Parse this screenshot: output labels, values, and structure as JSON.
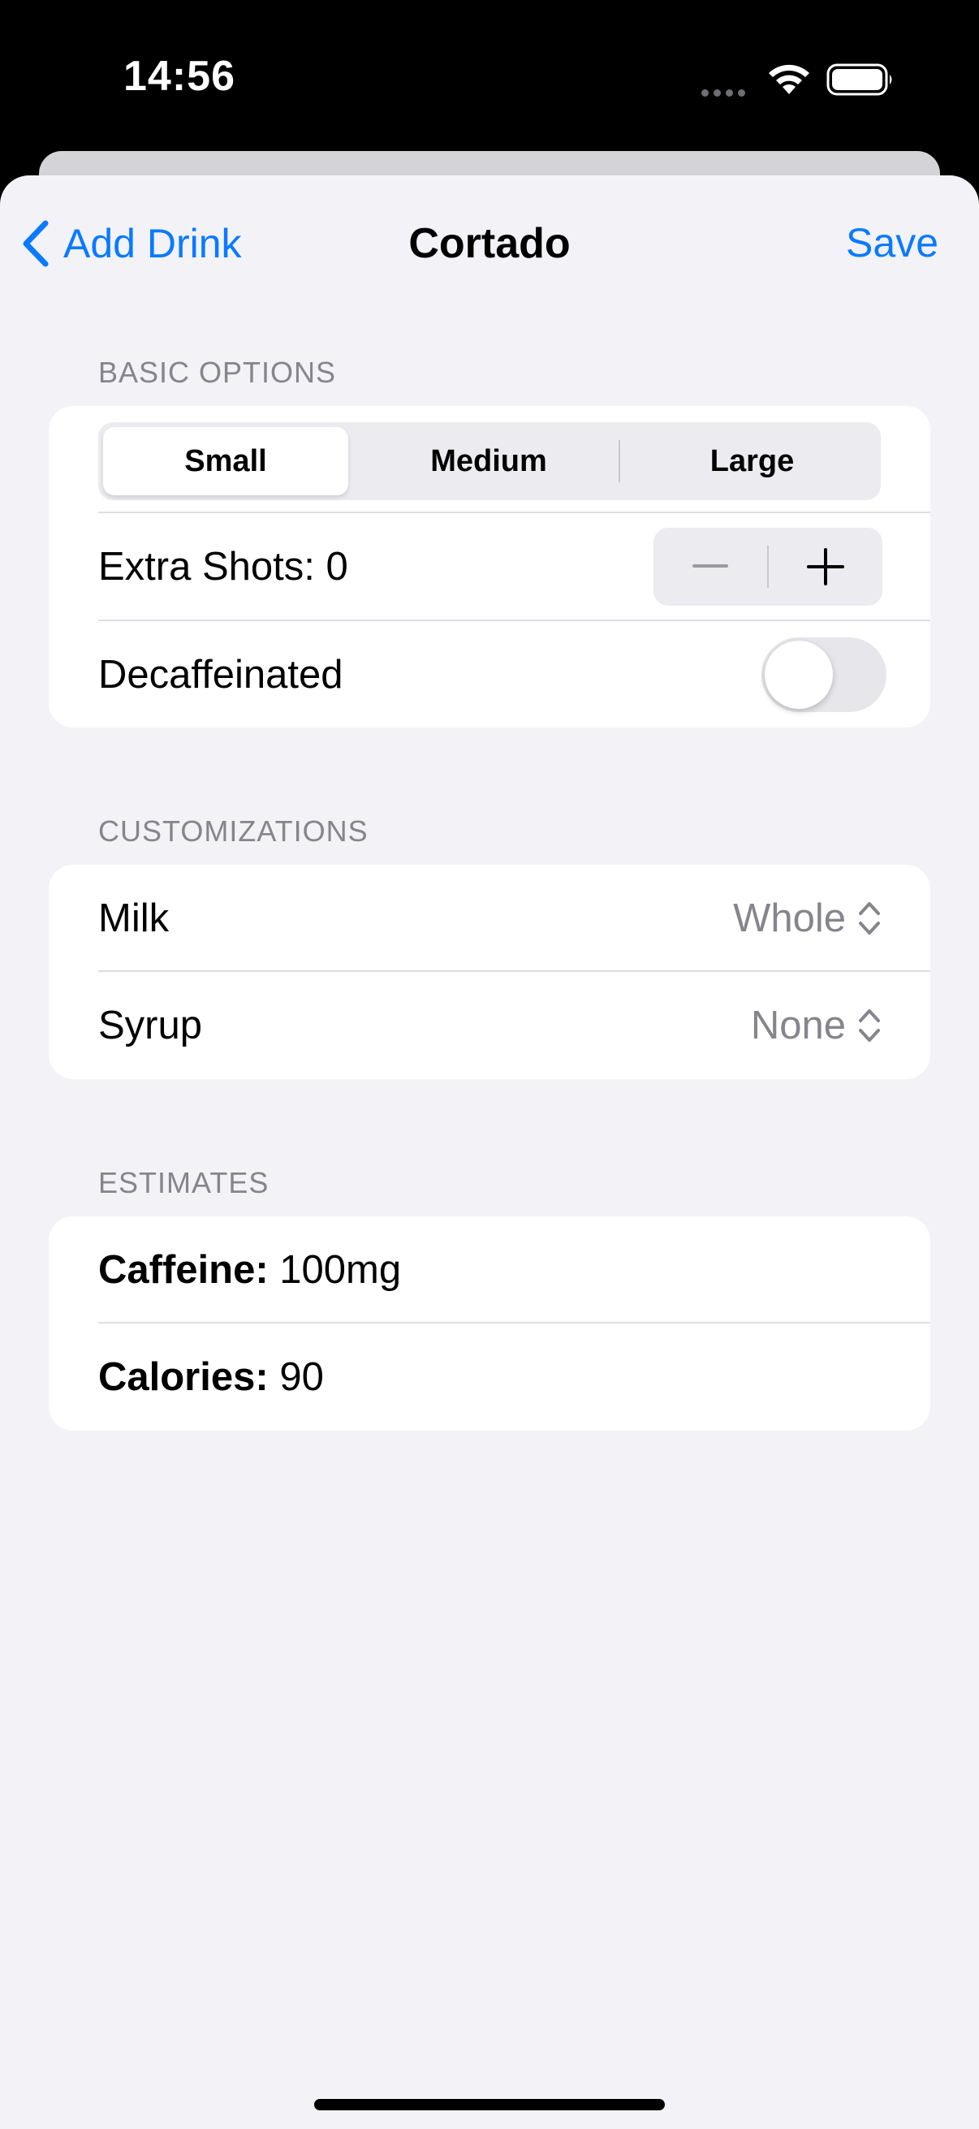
{
  "status_bar": {
    "time": "14:56"
  },
  "nav": {
    "back_label": "Add Drink",
    "title": "Cortado",
    "save_label": "Save"
  },
  "basic_options": {
    "header": "BASIC OPTIONS",
    "sizes": [
      "Small",
      "Medium",
      "Large"
    ],
    "selected_size": "Small",
    "extra_shots_label": "Extra Shots:",
    "extra_shots_value": "0",
    "decaf_label": "Decaffeinated",
    "decaf_on": false
  },
  "customizations": {
    "header": "CUSTOMIZATIONS",
    "milk_label": "Milk",
    "milk_value": "Whole",
    "syrup_label": "Syrup",
    "syrup_value": "None"
  },
  "estimates": {
    "header": "ESTIMATES",
    "caffeine_label": "Caffeine:",
    "caffeine_value": "100mg",
    "calories_label": "Calories:",
    "calories_value": "90"
  },
  "colors": {
    "accent": "#0a7aff",
    "background": "#f2f2f7",
    "secondary_text": "#85858b"
  }
}
